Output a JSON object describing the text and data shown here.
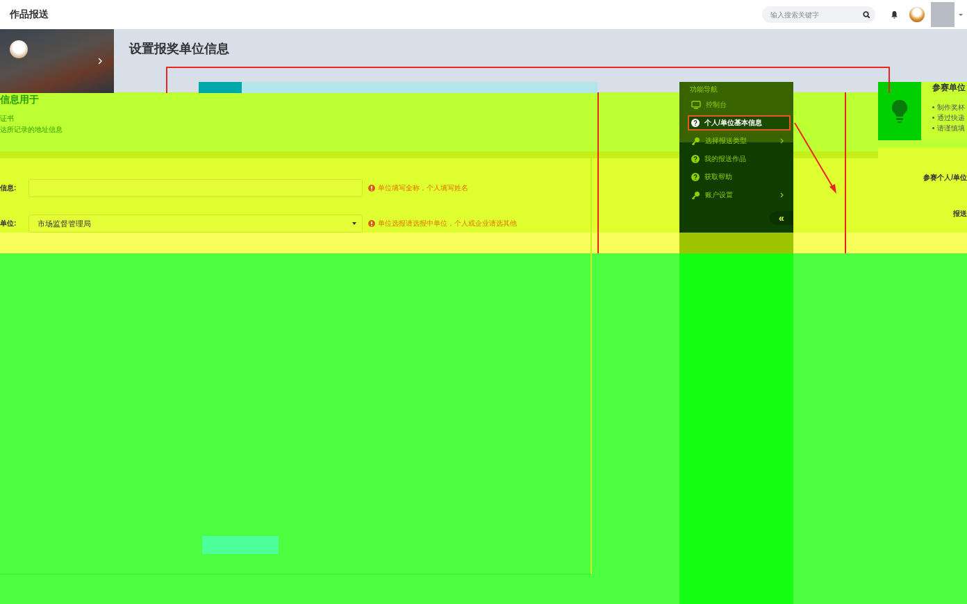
{
  "header": {
    "title": "作品报送",
    "search": {
      "placeholder": "输入搜索关键字"
    }
  },
  "page_title": "设置报奖单位信息",
  "notice": {
    "heading": "信息用于",
    "lines": [
      "证书",
      "达所记录的地址信息"
    ]
  },
  "form": {
    "fields": [
      {
        "kind": "text",
        "label": "信息:",
        "hint": "单位填写全称，个人填写姓名"
      },
      {
        "kind": "select",
        "label": "单位:",
        "value": "市场监督管理局",
        "hint": "单位选报请选报中单位，个人或企业请选其他"
      }
    ]
  },
  "nav": {
    "heading": "功能导航",
    "collapse": "«",
    "items": [
      {
        "kind": "monitor",
        "label": "控制台",
        "selected": false,
        "submenu": false
      },
      {
        "kind": "help",
        "label": "个人/单位基本信息",
        "selected": true,
        "submenu": false
      },
      {
        "kind": "key",
        "label": "选择报送类型",
        "selected": false,
        "submenu": true
      },
      {
        "kind": "help",
        "label": "我的报送作品",
        "selected": false,
        "submenu": false
      },
      {
        "kind": "help",
        "label": "获取帮助",
        "selected": false,
        "submenu": false
      },
      {
        "kind": "key",
        "label": "账户设置",
        "selected": false,
        "submenu": true
      }
    ]
  },
  "tips": {
    "title": "参赛单位",
    "bullets": [
      "制作奖杯",
      "通过快递",
      "请谨慎填"
    ]
  },
  "entry": {
    "title": "参赛个人/单位",
    "label": "报送"
  }
}
